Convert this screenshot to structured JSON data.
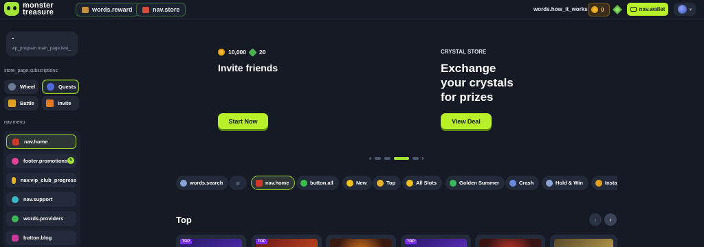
{
  "header": {
    "logo_line1": "monster",
    "logo_line2": "treasure",
    "reward_label": "words.reward",
    "store_label": "nav.store",
    "how_it_works": "words.how_it_works",
    "coin_balance": "0",
    "wallet_label": "nav.wallet"
  },
  "sidebar": {
    "vip_dash": "-",
    "vip_text": "vip_program.main_page.test_",
    "subscriptions_label": "store_page.subscriptions",
    "quick": [
      {
        "label": "Wheel",
        "icon": "wheel-icon",
        "color": "#6b7b96"
      },
      {
        "label": "Quests",
        "icon": "quests-icon",
        "color": "#4f6bd8"
      },
      {
        "label": "Battle",
        "icon": "trophy-icon",
        "color": "#e0a020"
      },
      {
        "label": "Invite",
        "icon": "invite-icon",
        "color": "#e07a20"
      }
    ],
    "menu_label": "nav.menu",
    "menu": [
      {
        "label": "nav.home",
        "icon": "home-icon",
        "color": "#d0382c"
      },
      {
        "label": "footer.promotions",
        "icon": "gift-icon",
        "color": "#e6449a",
        "badge": "5"
      },
      {
        "label": "nav.vip_club_progress",
        "icon": "crown-icon",
        "color": "#e8b12a"
      },
      {
        "label": "nav.support",
        "icon": "support-icon",
        "color": "#3bb8c8"
      },
      {
        "label": "words.providers",
        "icon": "clover-icon",
        "color": "#3bb85a"
      },
      {
        "label": "button.blog",
        "icon": "blog-icon",
        "color": "#c83a9a"
      }
    ]
  },
  "banner": {
    "left": {
      "coins": "10,000",
      "gems": "20",
      "title": "Invite friends",
      "cta": "Start Now"
    },
    "right": {
      "eyebrow": "CRYSTAL STORE",
      "title_l1": "Exchange",
      "title_l2": "your crystals",
      "title_l3": "for prizes",
      "cta": "View Deal"
    }
  },
  "chips": [
    {
      "label": "words.search",
      "icon": "search-icon",
      "color": "#8aa4d6"
    },
    {
      "label": "",
      "icon": "filter-icon",
      "color": "#8a94a8"
    },
    {
      "label": "nav.home",
      "icon": "home-icon",
      "color": "#d0382c"
    },
    {
      "label": "button.all",
      "icon": "star-icon",
      "color": "#3bbf4a"
    },
    {
      "label": "New",
      "icon": "bolt-icon",
      "color": "#f0c020"
    },
    {
      "label": "Top",
      "icon": "crown-icon",
      "color": "#e8b12a"
    },
    {
      "label": "All Slots",
      "icon": "star-icon",
      "color": "#f0c020"
    },
    {
      "label": "Golden Summer",
      "icon": "leaf-icon",
      "color": "#3bb85a"
    },
    {
      "label": "Crash",
      "icon": "rocket-icon",
      "color": "#6a8ae0"
    },
    {
      "label": "Hold & Win",
      "icon": "swords-icon",
      "color": "#8aa4d6"
    },
    {
      "label": "Instan",
      "icon": "medal-icon",
      "color": "#e0a020"
    }
  ],
  "section": {
    "title": "Top",
    "card_tag": "TOP"
  }
}
